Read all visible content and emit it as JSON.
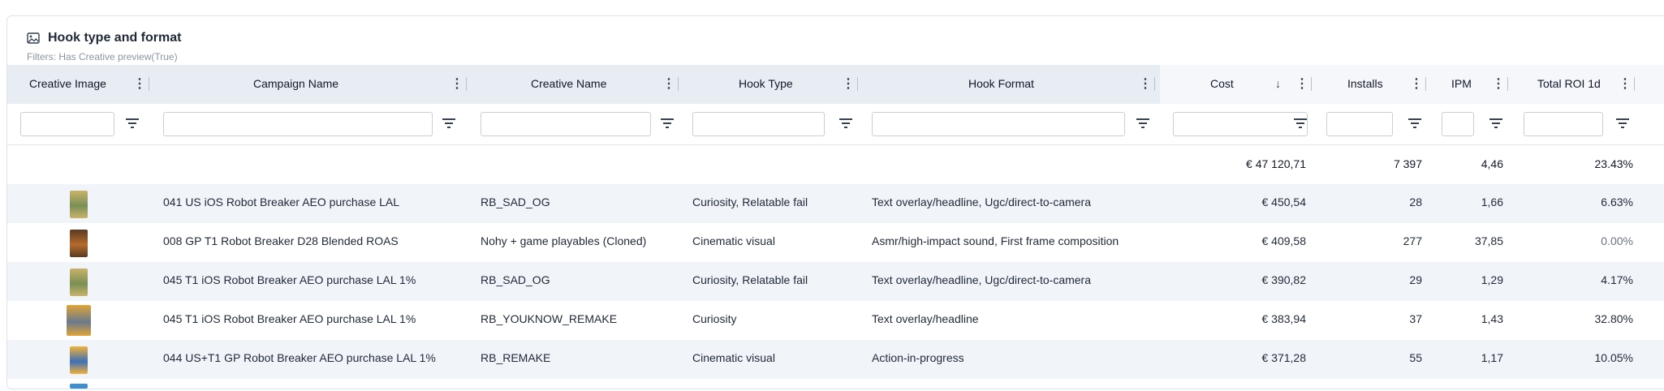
{
  "widget": {
    "title": "Hook type and format",
    "filters_note": "Filters: Has Creative preview(True)",
    "title_icon": "image-icon"
  },
  "columns": [
    {
      "key": "creative_image",
      "label": "Creative Image"
    },
    {
      "key": "campaign_name",
      "label": "Campaign Name"
    },
    {
      "key": "creative_name",
      "label": "Creative Name"
    },
    {
      "key": "hook_type",
      "label": "Hook Type"
    },
    {
      "key": "hook_format",
      "label": "Hook Format"
    },
    {
      "key": "cost",
      "label": "Cost",
      "sorted": "desc"
    },
    {
      "key": "installs",
      "label": "Installs"
    },
    {
      "key": "ipm",
      "label": "IPM"
    },
    {
      "key": "total_roi_1d",
      "label": "Total ROI 1d"
    }
  ],
  "totals": {
    "cost": "€ 47 120,71",
    "installs": "7 397",
    "ipm": "4,46",
    "total_roi_1d": "23.43%"
  },
  "rows": [
    {
      "thumb_colors": [
        "#c9b36a",
        "#7a8f55"
      ],
      "campaign_name": "041 US iOS Robot Breaker AEO purchase LAL",
      "creative_name": "RB_SAD_OG",
      "hook_type": "Curiosity, Relatable fail",
      "hook_format": "Text overlay/headline, Ugc/direct-to-camera",
      "cost": "€ 450,54",
      "installs": "28",
      "ipm": "1,66",
      "total_roi_1d": "6.63%"
    },
    {
      "thumb_colors": [
        "#5a3a22",
        "#b56b2c"
      ],
      "campaign_name": "008 GP T1 Robot Breaker D28 Blended ROAS",
      "creative_name": "Nohy + game playables (Cloned)",
      "hook_type": "Cinematic visual",
      "hook_format": "Asmr/high-impact sound, First frame composition",
      "cost": "€ 409,58",
      "installs": "277",
      "ipm": "37,85",
      "total_roi_1d": "0.00%"
    },
    {
      "thumb_colors": [
        "#c9b36a",
        "#7a8f55"
      ],
      "campaign_name": "045 T1 iOS Robot Breaker AEO purchase LAL 1%",
      "creative_name": "RB_SAD_OG",
      "hook_type": "Curiosity, Relatable fail",
      "hook_format": "Text overlay/headline, Ugc/direct-to-camera",
      "cost": "€ 390,82",
      "installs": "29",
      "ipm": "1,29",
      "total_roi_1d": "4.17%"
    },
    {
      "thumb_colors": [
        "#e0a43a",
        "#6a7a8c"
      ],
      "campaign_name": "045 T1 iOS Robot Breaker AEO purchase LAL 1%",
      "creative_name": "RB_YOUKNOW_REMAKE",
      "hook_type": "Curiosity",
      "hook_format": "Text overlay/headline",
      "cost": "€ 383,94",
      "installs": "37",
      "ipm": "1,43",
      "total_roi_1d": "32.80%"
    },
    {
      "thumb_colors": [
        "#f2b23a",
        "#3d6fb8"
      ],
      "campaign_name": "044 US+T1 GP Robot Breaker AEO purchase LAL 1%",
      "creative_name": "RB_REMAKE",
      "hook_type": "Cinematic visual",
      "hook_format": "Action-in-progress",
      "cost": "€ 371,28",
      "installs": "55",
      "ipm": "1,17",
      "total_roi_1d": "10.05%"
    }
  ],
  "colors": {
    "header_bg": "#e8edf3",
    "alt_row_bg": "#f1f4f8",
    "border": "#dfe3e8"
  }
}
